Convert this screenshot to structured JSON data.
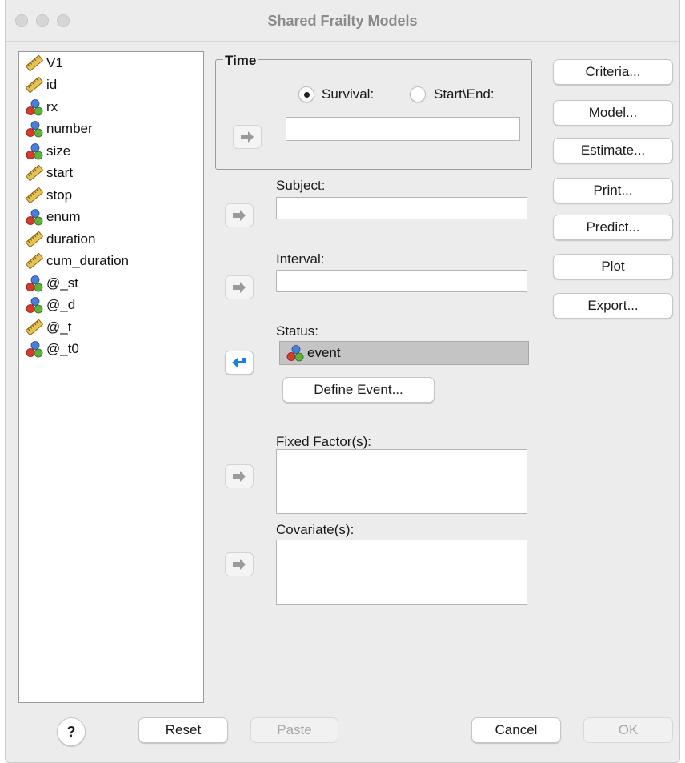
{
  "window": {
    "title": "Shared Frailty Models"
  },
  "variables": [
    {
      "name": "V1",
      "icon": "ruler-icon"
    },
    {
      "name": "id",
      "icon": "ruler-icon"
    },
    {
      "name": "rx",
      "icon": "nominal-icon"
    },
    {
      "name": "number",
      "icon": "nominal-icon"
    },
    {
      "name": "size",
      "icon": "nominal-icon"
    },
    {
      "name": "start",
      "icon": "ruler-icon"
    },
    {
      "name": "stop",
      "icon": "ruler-icon"
    },
    {
      "name": "enum",
      "icon": "nominal-icon"
    },
    {
      "name": "duration",
      "icon": "ruler-icon"
    },
    {
      "name": "cum_duration",
      "icon": "ruler-icon"
    },
    {
      "name": "@_st",
      "icon": "nominal-icon"
    },
    {
      "name": "@_d",
      "icon": "nominal-icon"
    },
    {
      "name": "@_t",
      "icon": "ruler-icon"
    },
    {
      "name": "@_t0",
      "icon": "nominal-icon"
    }
  ],
  "time": {
    "legend": "Time",
    "survival_label": "Survival:",
    "startend_label": "Start\\End:",
    "selected": "Survival",
    "value": ""
  },
  "subject": {
    "label": "Subject:",
    "value": ""
  },
  "interval": {
    "label": "Interval:",
    "value": ""
  },
  "status": {
    "label": "Status:",
    "value": "event",
    "define_event_label": "Define Event..."
  },
  "fixed_factors": {
    "label": "Fixed Factor(s):"
  },
  "covariates": {
    "label": "Covariate(s):"
  },
  "side_buttons": {
    "criteria": "Criteria...",
    "model": "Model...",
    "estimate": "Estimate...",
    "print": "Print...",
    "predict": "Predict...",
    "plot": "Plot",
    "export": "Export..."
  },
  "footer": {
    "help": "?",
    "reset": "Reset",
    "paste": "Paste",
    "cancel": "Cancel",
    "ok": "OK"
  },
  "colors": {
    "arrow_inactive": "#9a9a9a",
    "arrow_active": "#1a7ee8",
    "status_field_bg": "#c4c4c4"
  }
}
